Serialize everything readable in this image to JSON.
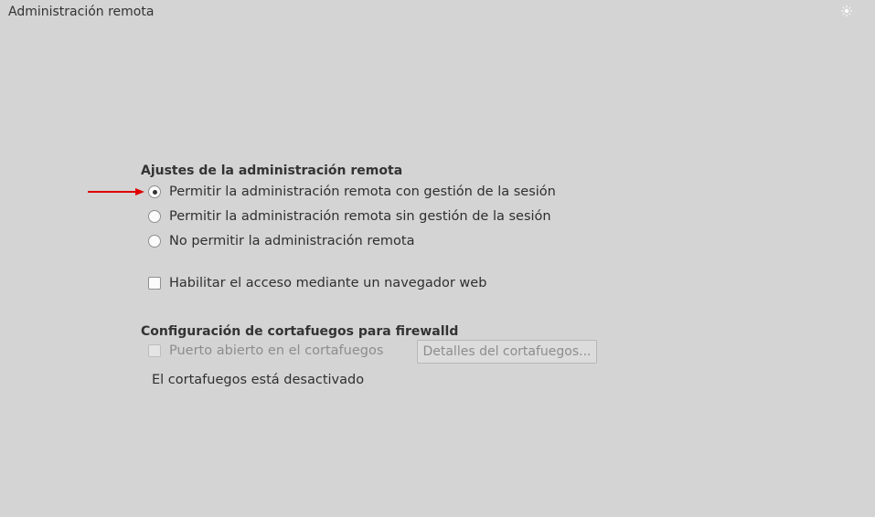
{
  "window": {
    "title": "Administración remota"
  },
  "icons": {
    "theme_toggle": "sun-moon-icon",
    "arrow": "red-arrow-icon"
  },
  "colors": {
    "background": "#d4d4d4",
    "arrow": "#e00000"
  },
  "remote_settings": {
    "heading": "Ajustes de la administración remota",
    "options": [
      {
        "label": "Permitir la administración remota con gestión de la sesión",
        "checked": true
      },
      {
        "label": "Permitir la administración remota sin gestión de la sesión",
        "checked": false
      },
      {
        "label": "No permitir la administración remota",
        "checked": false
      }
    ],
    "web_access": {
      "label": "Habilitar el acceso mediante un navegador web",
      "checked": false
    }
  },
  "firewall": {
    "heading": "Configuración de cortafuegos para firewalld",
    "open_port": {
      "label": "Puerto abierto en el cortafuegos",
      "checked": false,
      "enabled": false
    },
    "details_button": "Detalles del cortafuegos...",
    "status": "El cortafuegos está desactivado"
  }
}
